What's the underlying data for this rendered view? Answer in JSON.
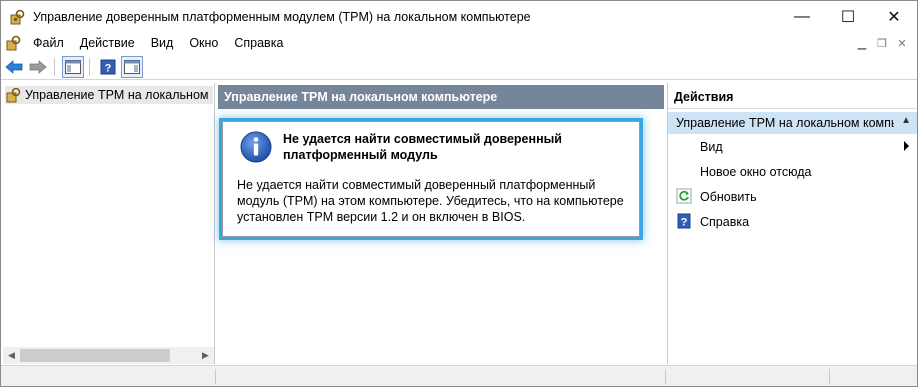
{
  "window": {
    "title": "Управление доверенным платформенным модулем (TPM) на локальном компьютере",
    "minimize_glyph": "—",
    "maximize_glyph": "☐",
    "close_glyph": "✕"
  },
  "menubar": {
    "items": [
      "Файл",
      "Действие",
      "Вид",
      "Окно",
      "Справка"
    ]
  },
  "toolbar": {
    "buttons": [
      "back-arrow-icon",
      "forward-arrow-icon",
      "show-hide-console-tree-icon",
      "help-icon",
      "show-hide-action-pane-icon"
    ]
  },
  "tree": {
    "root_label": "Управление TPM на локальном компьютере"
  },
  "center": {
    "header": "Управление TPM на локальном компьютере",
    "message": {
      "title": "Не удается найти совместимый доверенный платформенный модуль",
      "body": "Не удается найти совместимый доверенный платформенный модуль (TPM) на этом компьютере. Убедитесь, что на компьютере установлен TPM версии 1.2 и он включен в BIOS."
    }
  },
  "actions": {
    "header": "Действия",
    "group_label": "Управление TPM на локальном компьютере",
    "items": [
      {
        "label": "Вид",
        "icon": "none",
        "submenu": true
      },
      {
        "label": "Новое окно отсюда",
        "icon": "none"
      },
      {
        "label": "Обновить",
        "icon": "refresh-icon"
      },
      {
        "label": "Справка",
        "icon": "help-icon"
      }
    ]
  },
  "colors": {
    "pane_header_bg": "#75869a",
    "action_group_bg": "#cfe3f7",
    "highlight_glow": "#3aa6e0"
  }
}
